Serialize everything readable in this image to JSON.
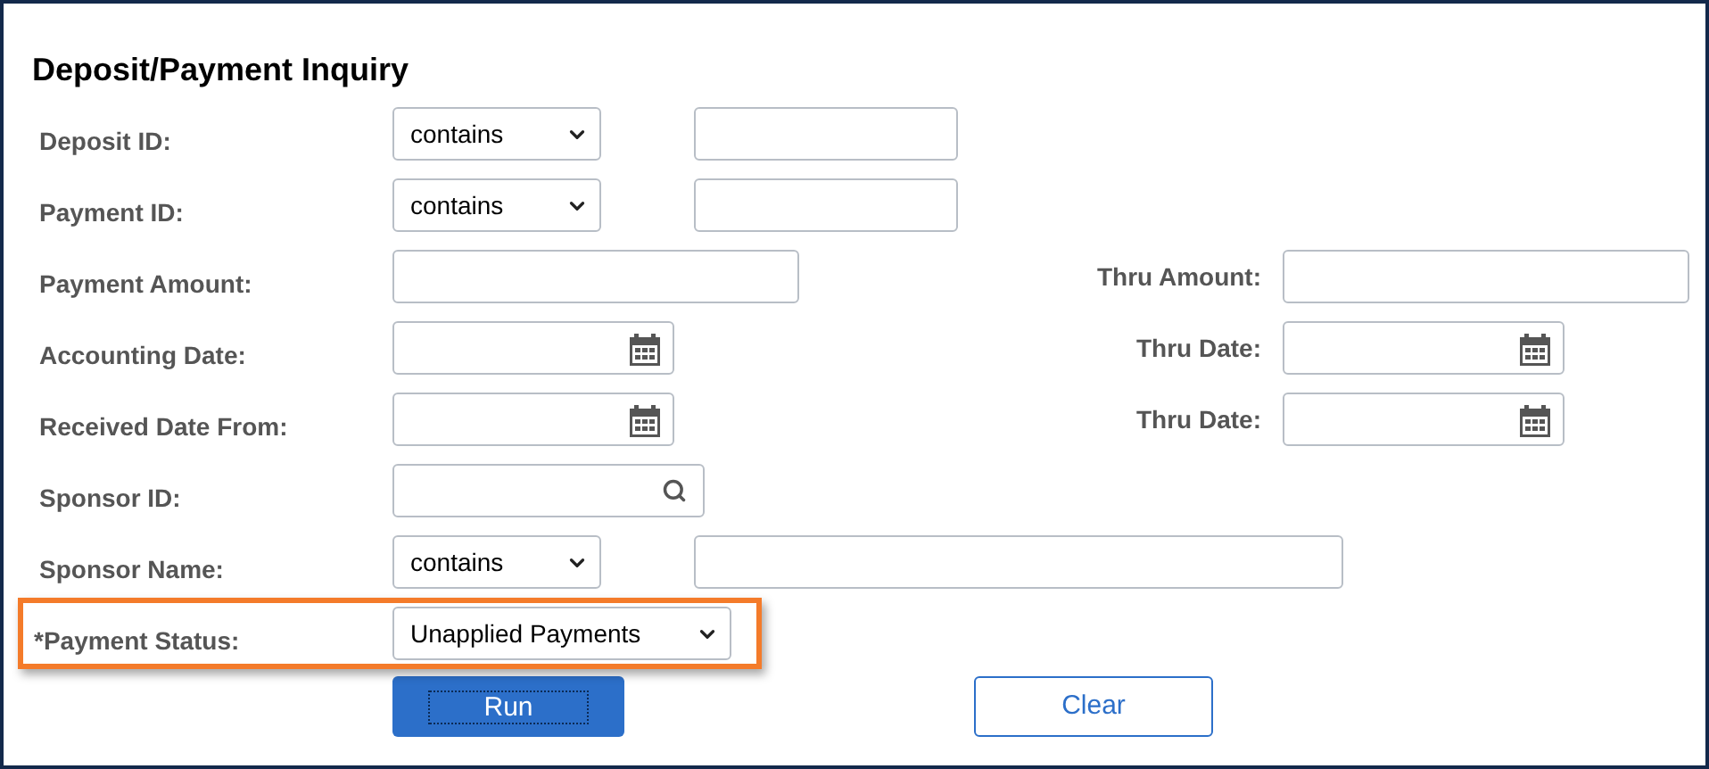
{
  "title": "Deposit/Payment Inquiry",
  "fields": [
    {
      "label": "Deposit ID:",
      "highlighted": false,
      "controls": [
        {
          "kind": "select",
          "value": "contains"
        },
        {
          "kind": "text"
        }
      ]
    },
    {
      "label": "Payment ID:",
      "highlighted": false,
      "controls": [
        {
          "kind": "select",
          "value": "contains"
        },
        {
          "kind": "text"
        }
      ]
    },
    {
      "label": "Payment Amount:",
      "highlighted": false,
      "controls": [
        {
          "kind": "amount"
        }
      ],
      "right": {
        "label": "Thru Amount:",
        "control": {
          "kind": "amount"
        }
      }
    },
    {
      "label": "Accounting Date:",
      "highlighted": false,
      "controls": [
        {
          "kind": "date"
        }
      ],
      "right": {
        "label": "Thru Date:",
        "control": {
          "kind": "date"
        }
      }
    },
    {
      "label": "Received Date From:",
      "highlighted": false,
      "controls": [
        {
          "kind": "date"
        }
      ],
      "right": {
        "label": "Thru Date:",
        "control": {
          "kind": "date"
        }
      }
    },
    {
      "label": "Sponsor ID:",
      "highlighted": false,
      "controls": [
        {
          "kind": "lookup"
        }
      ]
    },
    {
      "label": "Sponsor Name:",
      "highlighted": false,
      "controls": [
        {
          "kind": "select",
          "value": "contains"
        },
        {
          "kind": "long-text"
        }
      ]
    },
    {
      "label": "*Payment Status:",
      "highlighted": true,
      "controls": [
        {
          "kind": "status-select",
          "value": "Unapplied Payments"
        }
      ]
    }
  ],
  "buttons": [
    {
      "label": "Run",
      "kind": "primary"
    },
    {
      "label": "Clear",
      "kind": "secondary"
    }
  ]
}
